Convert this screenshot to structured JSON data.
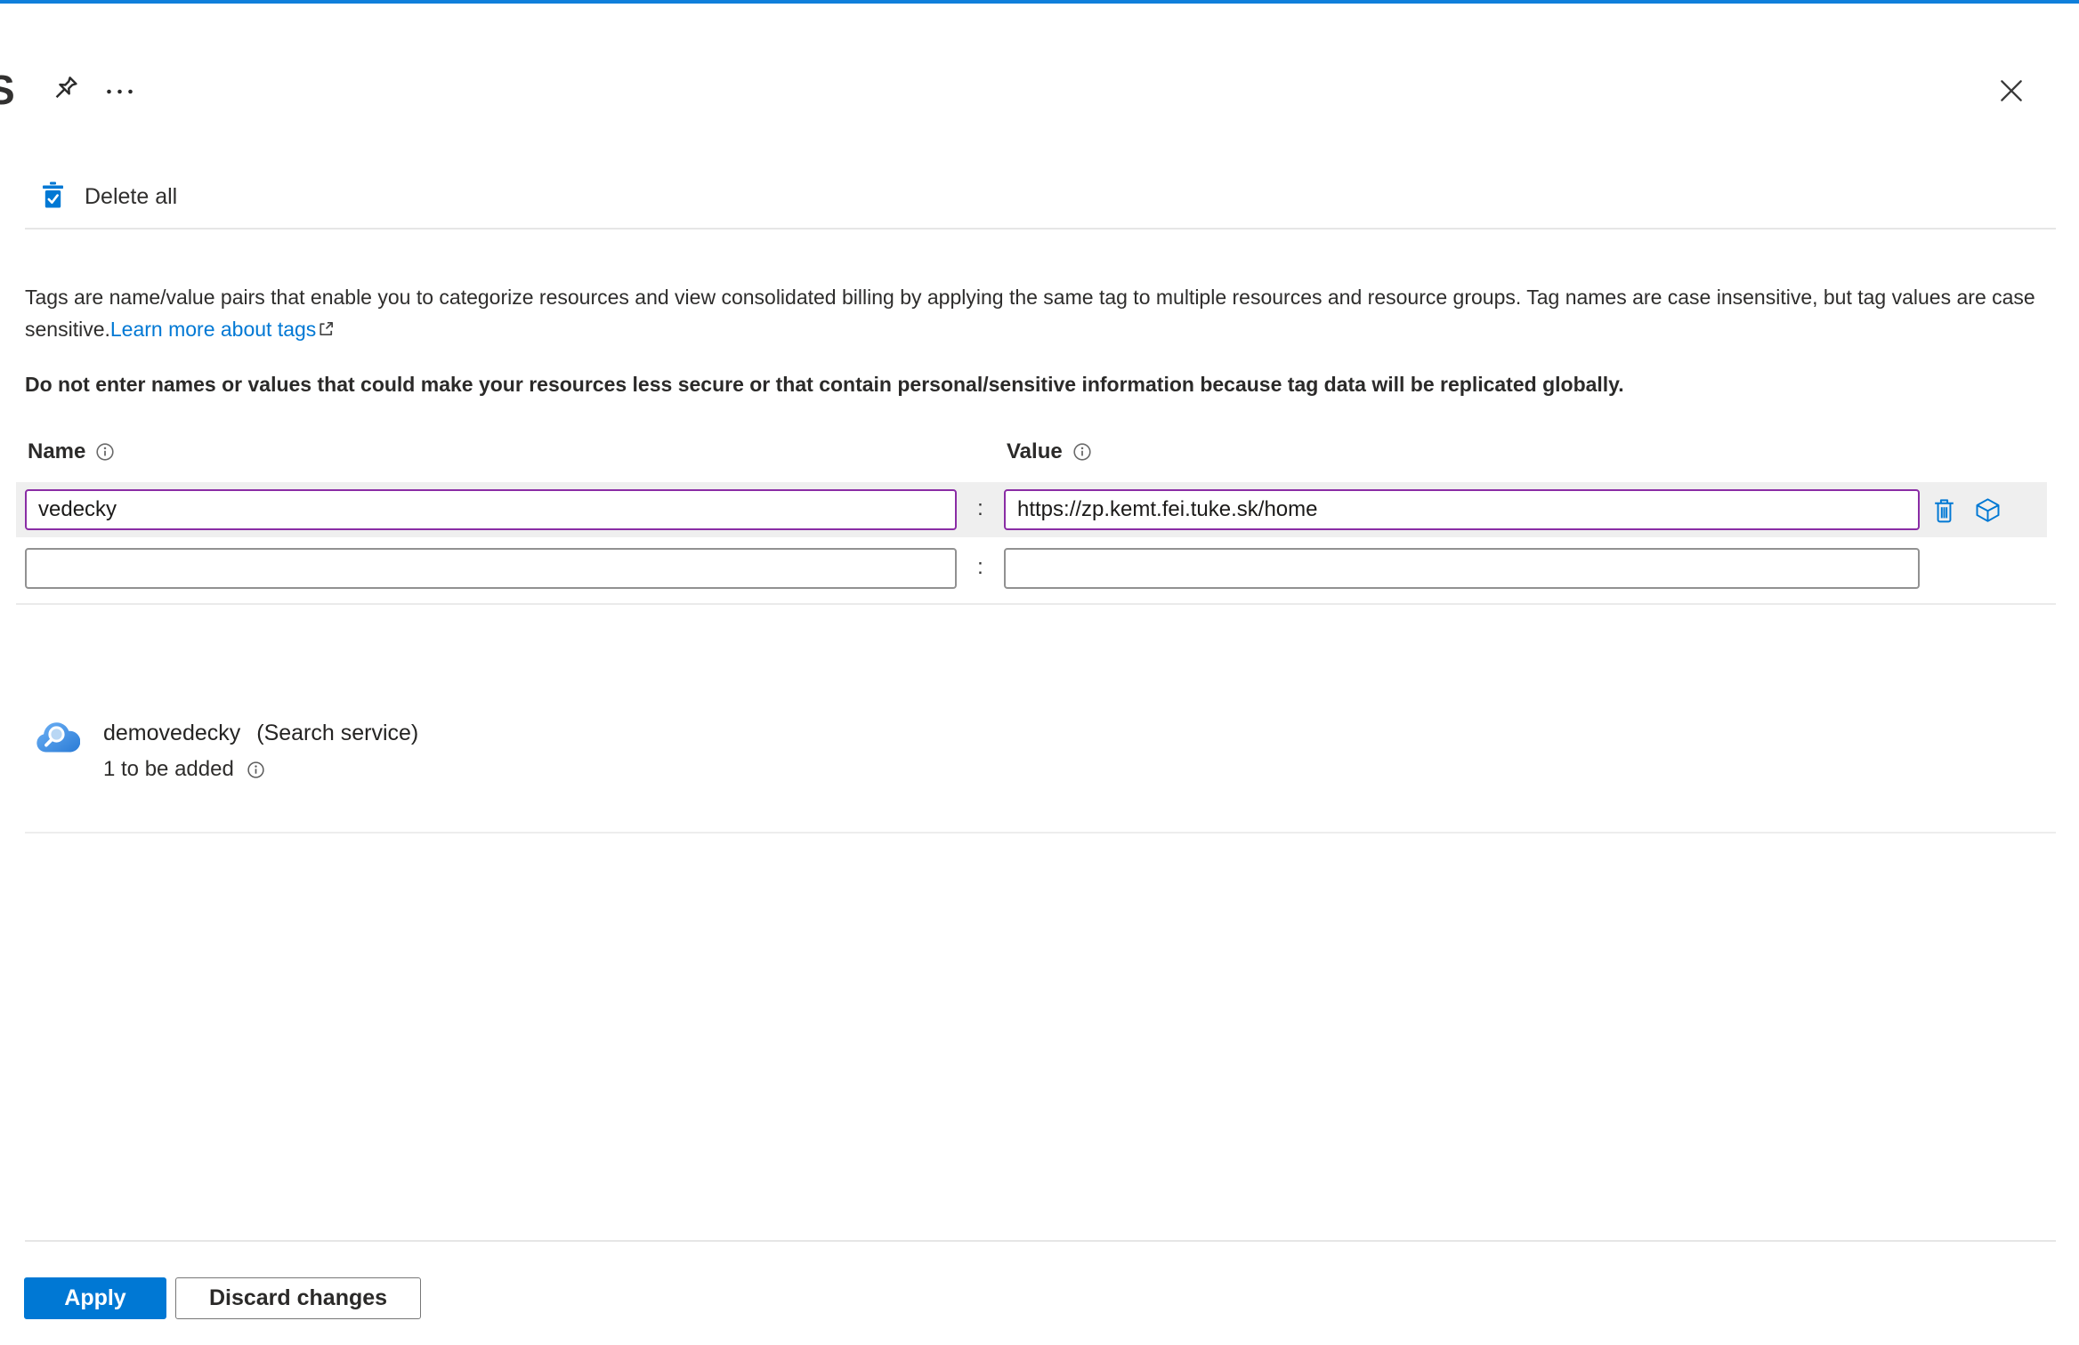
{
  "window": {
    "title_partial": "S"
  },
  "toolbar": {
    "delete_all_label": "Delete all"
  },
  "intro": {
    "description": "Tags are name/value pairs that enable you to categorize resources and view consolidated billing by applying the same tag to multiple resources and resource groups. Tag names are case insensitive, but tag values are case sensitive.",
    "learn_more_label": "Learn more about tags",
    "warning": "Do not enter names or values that could make your resources less secure or that contain personal/sensitive information because tag data will be replicated globally."
  },
  "tags_table": {
    "name_header": "Name",
    "value_header": "Value",
    "colon": ":",
    "rows": [
      {
        "name": "vedecky",
        "value": "https://zp.kemt.fei.tuke.sk/home"
      },
      {
        "name": "",
        "value": ""
      }
    ]
  },
  "resource": {
    "name": "demovedecky",
    "type_label": "(Search service)",
    "pending_label": "1 to be added"
  },
  "footer": {
    "apply_label": "Apply",
    "discard_label": "Discard changes"
  },
  "colors": {
    "accent": "#0078d4",
    "modified_field_border": "#8a2da5",
    "row_highlight": "#efefef",
    "topbar": "#0f7fdb"
  }
}
